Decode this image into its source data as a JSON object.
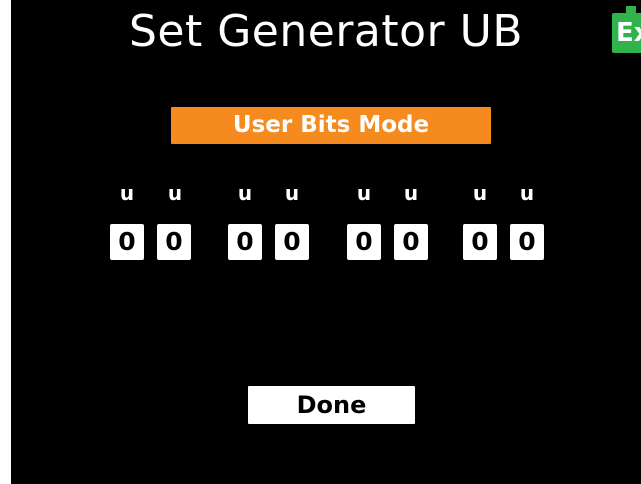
{
  "header": {
    "title": "Set Generator UB"
  },
  "battery": {
    "label": "Ex",
    "color": "#2fb34a"
  },
  "mode": {
    "label": "User Bits Mode",
    "color": "#f58a1f"
  },
  "user_bits": {
    "labels": [
      "u",
      "u",
      "u",
      "u",
      "u",
      "u",
      "u",
      "u"
    ],
    "values": [
      "0",
      "0",
      "0",
      "0",
      "0",
      "0",
      "0",
      "0"
    ]
  },
  "actions": {
    "done_label": "Done"
  }
}
